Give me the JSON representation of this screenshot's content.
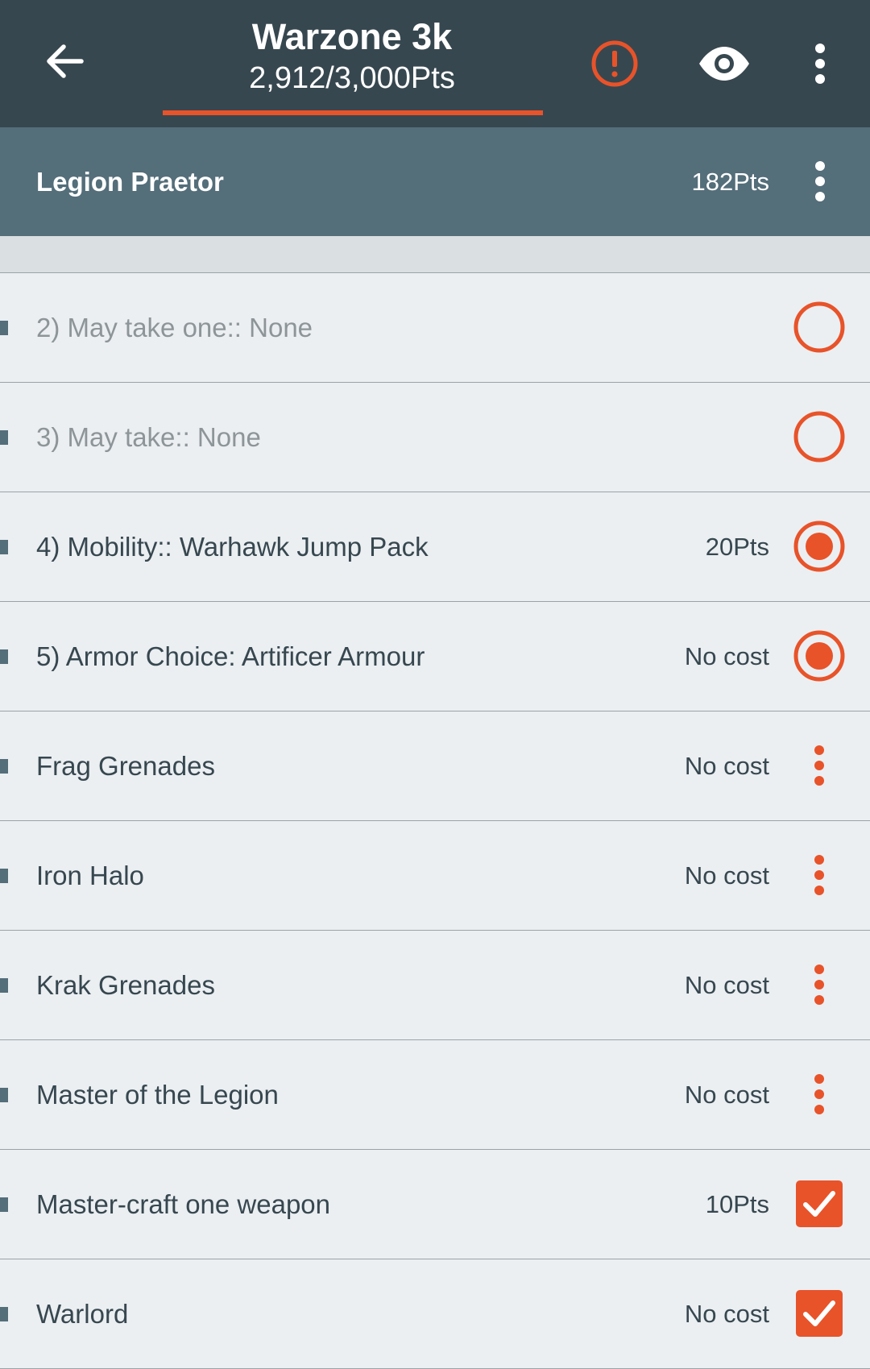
{
  "app_bar": {
    "title": "Warzone 3k",
    "subtitle": "2,912/3,000Pts",
    "points_used": 2912,
    "points_limit": 3000,
    "progress_fraction": 0.971,
    "back_icon": "arrow-left-icon",
    "warning_icon": "alert-circle-icon",
    "visibility_icon": "eye-icon",
    "menu_icon": "more-vert-icon"
  },
  "unit": {
    "name": "Legion Praetor",
    "points": "182Pts",
    "menu_icon": "more-vert-icon"
  },
  "colors": {
    "app_bar": "#37474f",
    "unit_header": "#546e7a",
    "accent": "#e8532a",
    "background": "#ebeff2",
    "divider": "#9aa3a8"
  },
  "options": [
    {
      "label": "2) May take one:: None",
      "cost": "",
      "control": "radio",
      "checked": false,
      "disabled": true
    },
    {
      "label": "3) May take:: None",
      "cost": "",
      "control": "radio",
      "checked": false,
      "disabled": true
    },
    {
      "label": "4) Mobility:: Warhawk Jump Pack",
      "cost": "20Pts",
      "control": "radio",
      "checked": true,
      "disabled": false
    },
    {
      "label": "5) Armor Choice: Artificer Armour",
      "cost": "No cost",
      "control": "radio",
      "checked": true,
      "disabled": false
    },
    {
      "label": "Frag Grenades",
      "cost": "No cost",
      "control": "menu",
      "checked": false,
      "disabled": false
    },
    {
      "label": "Iron Halo",
      "cost": "No cost",
      "control": "menu",
      "checked": false,
      "disabled": false
    },
    {
      "label": "Krak Grenades",
      "cost": "No cost",
      "control": "menu",
      "checked": false,
      "disabled": false
    },
    {
      "label": "Master of the Legion",
      "cost": "No cost",
      "control": "menu",
      "checked": false,
      "disabled": false
    },
    {
      "label": "Master-craft one weapon",
      "cost": "10Pts",
      "control": "checkbox",
      "checked": true,
      "disabled": false
    },
    {
      "label": "Warlord",
      "cost": "No cost",
      "control": "checkbox",
      "checked": true,
      "disabled": false
    }
  ]
}
